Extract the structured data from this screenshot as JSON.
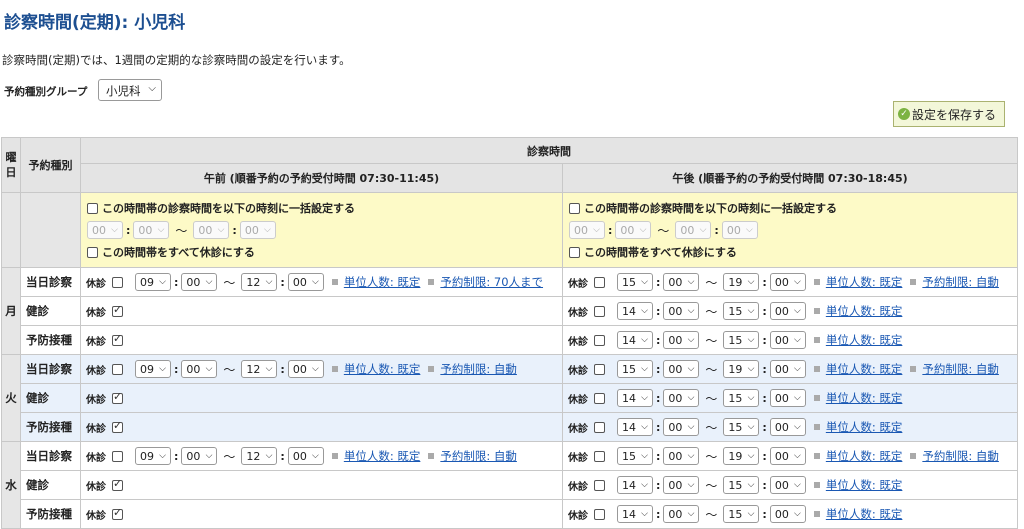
{
  "page": {
    "title": "診察時間(定期): 小児科",
    "description": "診察時間(定期)では、1週間の定期的な診察時間の設定を行います。",
    "group_label": "予約種別グループ",
    "group_value": "小児科",
    "save_label": "設定を保存する"
  },
  "table": {
    "col_day": "曜日",
    "col_kind": "予約種別",
    "col_time": "診察時間",
    "am_header": "午前 (順番予約の予約受付時間 07:30-11:45)",
    "pm_header": "午後 (順番予約の予約受付時間 07:30-18:45)",
    "bulk_set": "この時間帯の診察時間を以下の時刻に一括設定する",
    "bulk_closed": "この時間帯をすべて休診にする",
    "bulk_time": "00",
    "tilde": "〜",
    "closed_label": "休診"
  },
  "days": [
    {
      "day": "月",
      "rows": [
        {
          "kind": "当日診察",
          "am": {
            "closed": false,
            "start_h": "09",
            "start_m": "00",
            "end_h": "12",
            "end_m": "00",
            "units": "単位人数: 既定",
            "limit": "予約制限: 70人まで"
          },
          "pm": {
            "closed": false,
            "start_h": "15",
            "start_m": "00",
            "end_h": "19",
            "end_m": "00",
            "units": "単位人数: 既定",
            "limit": "予約制限: 自動"
          }
        },
        {
          "kind": "健診",
          "am": {
            "closed": true
          },
          "pm": {
            "closed": false,
            "start_h": "14",
            "start_m": "00",
            "end_h": "15",
            "end_m": "00",
            "units": "単位人数: 既定"
          }
        },
        {
          "kind": "予防接種",
          "am": {
            "closed": true
          },
          "pm": {
            "closed": false,
            "start_h": "14",
            "start_m": "00",
            "end_h": "15",
            "end_m": "00",
            "units": "単位人数: 既定"
          }
        }
      ]
    },
    {
      "day": "火",
      "rows": [
        {
          "kind": "当日診察",
          "am": {
            "closed": false,
            "start_h": "09",
            "start_m": "00",
            "end_h": "12",
            "end_m": "00",
            "units": "単位人数: 既定",
            "limit": "予約制限: 自動"
          },
          "pm": {
            "closed": false,
            "start_h": "15",
            "start_m": "00",
            "end_h": "19",
            "end_m": "00",
            "units": "単位人数: 既定",
            "limit": "予約制限: 自動"
          }
        },
        {
          "kind": "健診",
          "am": {
            "closed": true
          },
          "pm": {
            "closed": false,
            "start_h": "14",
            "start_m": "00",
            "end_h": "15",
            "end_m": "00",
            "units": "単位人数: 既定"
          }
        },
        {
          "kind": "予防接種",
          "am": {
            "closed": true
          },
          "pm": {
            "closed": false,
            "start_h": "14",
            "start_m": "00",
            "end_h": "15",
            "end_m": "00",
            "units": "単位人数: 既定"
          }
        }
      ]
    },
    {
      "day": "水",
      "rows": [
        {
          "kind": "当日診察",
          "am": {
            "closed": false,
            "start_h": "09",
            "start_m": "00",
            "end_h": "12",
            "end_m": "00",
            "units": "単位人数: 既定",
            "limit": "予約制限: 自動"
          },
          "pm": {
            "closed": false,
            "start_h": "15",
            "start_m": "00",
            "end_h": "19",
            "end_m": "00",
            "units": "単位人数: 既定",
            "limit": "予約制限: 自動"
          }
        },
        {
          "kind": "健診",
          "am": {
            "closed": true
          },
          "pm": {
            "closed": false,
            "start_h": "14",
            "start_m": "00",
            "end_h": "15",
            "end_m": "00",
            "units": "単位人数: 既定"
          }
        },
        {
          "kind": "予防接種",
          "am": {
            "closed": true
          },
          "pm": {
            "closed": false,
            "start_h": "14",
            "start_m": "00",
            "end_h": "15",
            "end_m": "00",
            "units": "単位人数: 既定"
          }
        }
      ]
    }
  ]
}
